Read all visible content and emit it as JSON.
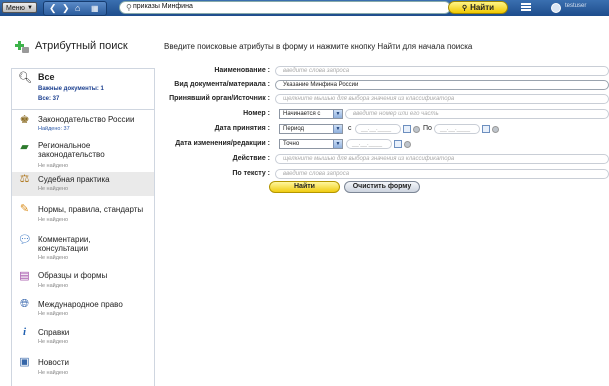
{
  "topbar": {
    "menu_label": "Меню",
    "search_value": "приказы Минфина",
    "find_label": "Найти",
    "user_name": "testuser"
  },
  "sidebar": {
    "heading": "Атрибутный поиск",
    "all": {
      "title": "Все",
      "important": "Важные документы: 1",
      "total": "Все: 37"
    },
    "items": [
      {
        "title": "Законодательство России",
        "status": "Найдено: 37",
        "icon": "russia-emblem-icon"
      },
      {
        "title": "Региональное законодательство",
        "status": "Не найдено",
        "icon": "region-map-icon"
      },
      {
        "title": "Судебная практика",
        "status": "Не найдено",
        "icon": "scales-icon"
      },
      {
        "title": "Нормы, правила, стандарты",
        "status": "Не найдено",
        "icon": "compass-icon"
      },
      {
        "title": "Комментарии, консультации",
        "status": "Не найдено",
        "icon": "chat-icon"
      },
      {
        "title": "Образцы и формы",
        "status": "Не найдено",
        "icon": "forms-icon"
      },
      {
        "title": "Международное право",
        "status": "Не найдено",
        "icon": "globe-icon"
      },
      {
        "title": "Справки",
        "status": "Не найдено",
        "icon": "info-icon"
      },
      {
        "title": "Новости",
        "status": "Не найдено",
        "icon": "news-icon"
      }
    ]
  },
  "main": {
    "instruction": "Введите поисковые атрибуты в форму и нажмите кнопку Найти для начала поиска",
    "fields": {
      "name_label": "Наименование :",
      "name_placeholder": "введите слова запроса",
      "doctype_label": "Вид документа/материала :",
      "doctype_value": "Указание Минфина России",
      "authority_label": "Принявший орган/Источник :",
      "authority_placeholder": "щелкните мышью для выбора значения из классификатора",
      "number_label": "Номер :",
      "number_mode": "Начинается с",
      "number_placeholder": "введите номер или его часть",
      "date_label": "Дата принятия :",
      "date_mode": "Период",
      "date_from_label": "с",
      "date_to_label": "По",
      "change_label": "Дата изменения/редакции :",
      "change_mode": "Точно",
      "action_label": "Действие :",
      "action_placeholder": "щелкните мышью для выбора значения из классификатора",
      "text_label": "По тексту :",
      "text_placeholder": "введите слова запроса",
      "date_mask": "__.__.____"
    },
    "buttons": {
      "find": "Найти",
      "clear": "Очистить форму"
    }
  }
}
